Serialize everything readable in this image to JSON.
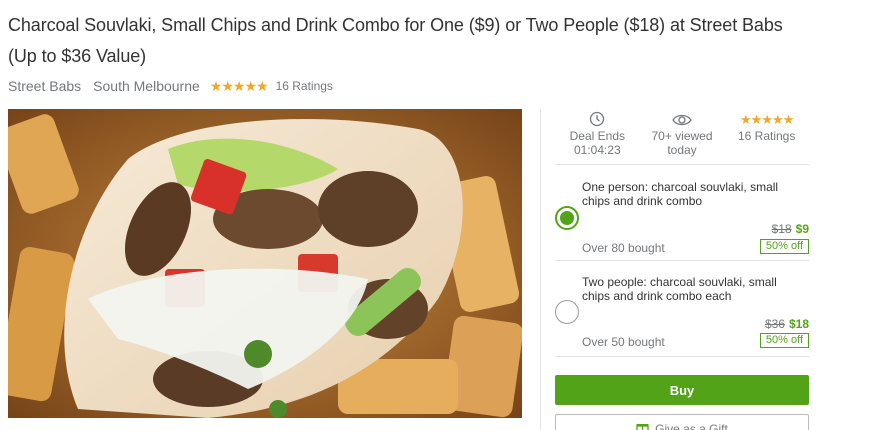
{
  "deal": {
    "title": "Charcoal Souvlaki, Small Chips and Drink Combo for One ($9) or Two People ($18) at Street Babs (Up to $36 Value)",
    "merchant": "Street Babs",
    "location": "South Melbourne",
    "stars": "★★★★★",
    "ratings": "16 Ratings"
  },
  "stats": {
    "deal_ends_label": "Deal Ends",
    "deal_ends_value": "01:04:23",
    "viewed_label": "70+ viewed",
    "viewed_sub": "today",
    "stars": "★★★★★",
    "ratings": "16 Ratings"
  },
  "options": [
    {
      "title": "One person: charcoal souvlaki, small chips and drink combo",
      "original_price": "$18",
      "price": "$9",
      "bought": "Over 80 bought",
      "discount": "50% off",
      "selected": true
    },
    {
      "title": "Two people: charcoal souvlaki, small chips and drink combo each",
      "original_price": "$36",
      "price": "$18",
      "bought": "Over 50 bought",
      "discount": "50% off",
      "selected": false
    }
  ],
  "actions": {
    "buy_label": "Buy",
    "gift_label": "Give as a Gift"
  },
  "colors": {
    "accent_green": "#53a318",
    "star_gold": "#f5a623"
  },
  "icons": {
    "clock": "clock-icon",
    "eye": "eye-icon",
    "gift": "gift-icon"
  }
}
